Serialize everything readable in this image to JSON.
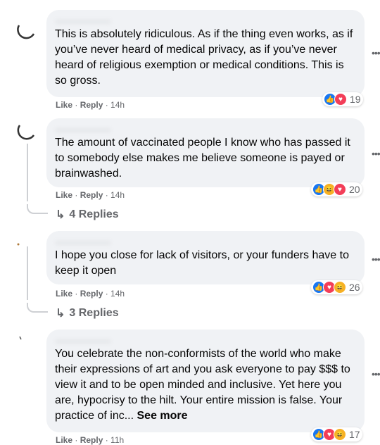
{
  "comments": [
    {
      "text": "This is absolutely ridiculous. As if the thing even works, as if you’ve never heard of medical privacy, as if you’ve never heard of religious exemption or medical conditions. This is so gross.",
      "like": "Like",
      "reply": "Reply",
      "time": "14h",
      "reactions": [
        "like",
        "love"
      ],
      "count": "19",
      "replies": ""
    },
    {
      "text": "The amount of vaccinated people I know who has passed it to somebody else makes me believe someone is payed or brainwashed.",
      "like": "Like",
      "reply": "Reply",
      "time": "14h",
      "reactions": [
        "like",
        "haha",
        "love"
      ],
      "count": "20",
      "replies": "4 Replies"
    },
    {
      "text": "I hope you close for lack of visitors, or your funders have to keep it open",
      "like": "Like",
      "reply": "Reply",
      "time": "14h",
      "reactions": [
        "like",
        "love",
        "haha"
      ],
      "count": "26",
      "replies": "3 Replies"
    },
    {
      "text": "You celebrate the non-conformists of the world who make their expressions of art and you ask everyone to pay $$$ to view it and to be open minded and inclusive. Yet here you are, hypocrisy to the hilt. Your entire mission is false. Your practice of inc...",
      "see_more": "See more",
      "like": "Like",
      "reply": "Reply",
      "time": "11h",
      "reactions": [
        "like",
        "love",
        "haha"
      ],
      "count": "17",
      "replies": ""
    }
  ],
  "colors": {
    "like": "#1877f2",
    "love": "#f33e58",
    "haha": "#f7b125",
    "bubble": "#f0f2f5",
    "meta": "#65676b"
  },
  "icons": {
    "reply_arrow": "reply-arrow-icon",
    "more": "more-options-icon"
  }
}
